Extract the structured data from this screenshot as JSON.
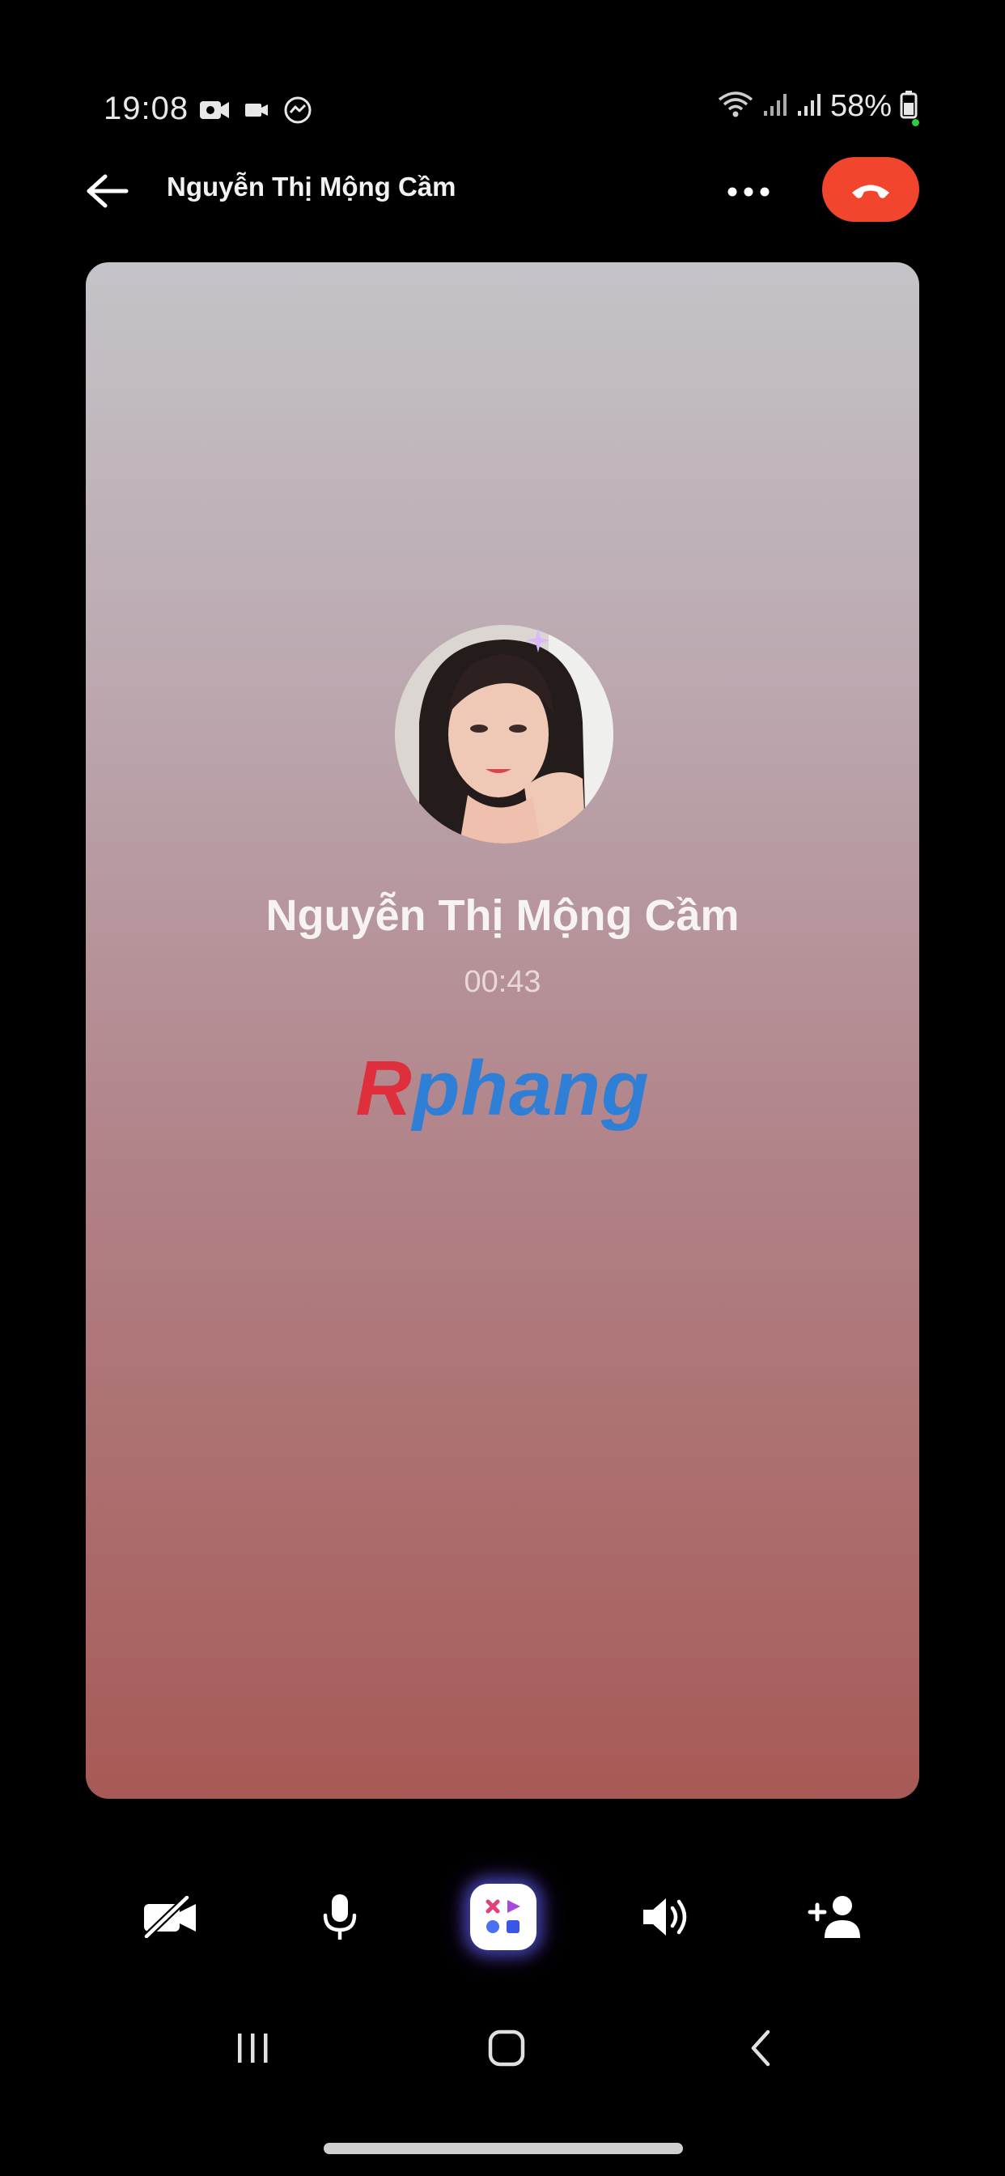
{
  "status_bar": {
    "time": "19:08",
    "battery": "58%",
    "left_icons": [
      "video-record-icon",
      "camera-icon",
      "messenger-icon"
    ],
    "right_icons": [
      "wifi-icon",
      "signal-icon",
      "signal-icon",
      "battery-icon"
    ]
  },
  "header": {
    "title": "Nguyễn Thị Mộng Cầm",
    "back_icon": "back-arrow-icon",
    "more_icon": "more-options-icon",
    "end_call_icon": "end-call-icon",
    "end_call_color": "#f2452e"
  },
  "call": {
    "caller_name": "Nguyễn Thị Mộng Cầm",
    "duration": "00:43"
  },
  "watermark": {
    "first_letter": "R",
    "rest": "phang"
  },
  "controls": [
    {
      "name": "camera-off",
      "icon": "video-off-icon"
    },
    {
      "name": "microphone",
      "icon": "microphone-icon"
    },
    {
      "name": "effects",
      "icon": "effects-icon"
    },
    {
      "name": "speaker",
      "icon": "speaker-icon"
    },
    {
      "name": "add-person",
      "icon": "add-person-icon"
    }
  ],
  "nav_bar": [
    "recent-apps-icon",
    "home-icon",
    "back-icon"
  ]
}
